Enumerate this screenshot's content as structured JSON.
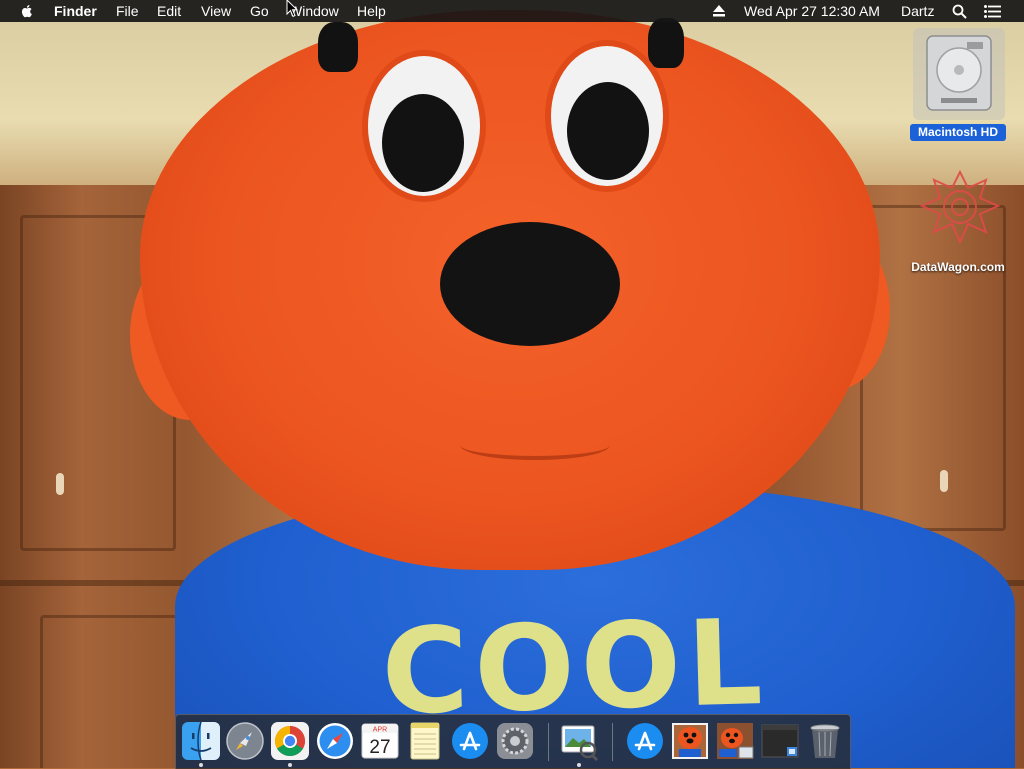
{
  "menubar": {
    "app_name": "Finder",
    "menus": [
      "File",
      "Edit",
      "View",
      "Go",
      "Window",
      "Help"
    ],
    "datetime": "Wed Apr 27  12:30 AM",
    "user": "Dartz"
  },
  "desktop": {
    "icons": [
      {
        "label": "Macintosh HD",
        "icon": "hard-drive-icon",
        "selected": true
      },
      {
        "label": "DataWagon.com",
        "icon": "datawagon-logo-icon"
      }
    ]
  },
  "wallpaper": {
    "shirt_text": "COOL"
  },
  "dock": {
    "calendar": {
      "month": "APR",
      "day": "27"
    },
    "items": [
      {
        "name": "finder",
        "icon": "finder-icon",
        "running": true
      },
      {
        "name": "launchpad",
        "icon": "launchpad-icon",
        "running": false
      },
      {
        "name": "chrome",
        "icon": "chrome-icon",
        "running": true
      },
      {
        "name": "safari",
        "icon": "safari-icon",
        "running": false
      },
      {
        "name": "calendar",
        "icon": "calendar-icon",
        "running": false
      },
      {
        "name": "notes",
        "icon": "notes-icon",
        "running": false
      },
      {
        "name": "app-store",
        "icon": "app-store-icon",
        "running": false
      },
      {
        "name": "system-preferences",
        "icon": "gear-icon",
        "running": false
      },
      {
        "name": "preview",
        "icon": "preview-icon",
        "running": true
      },
      {
        "name": "downloads",
        "icon": "app-store-icon",
        "running": false
      },
      {
        "name": "image-1",
        "icon": "image-thumbnail-icon",
        "running": false
      },
      {
        "name": "image-2",
        "icon": "image-thumbnail-icon",
        "running": false
      },
      {
        "name": "minimized-window",
        "icon": "window-thumbnail-icon",
        "running": false
      },
      {
        "name": "trash",
        "icon": "trash-icon",
        "running": false
      }
    ]
  },
  "colors": {
    "menubar_bg": "#161616",
    "selection_blue": "#1b62d8",
    "fur_orange": "#ec5520",
    "shirt_blue": "#1f5fcf",
    "shirt_text": "#dfe08a"
  }
}
